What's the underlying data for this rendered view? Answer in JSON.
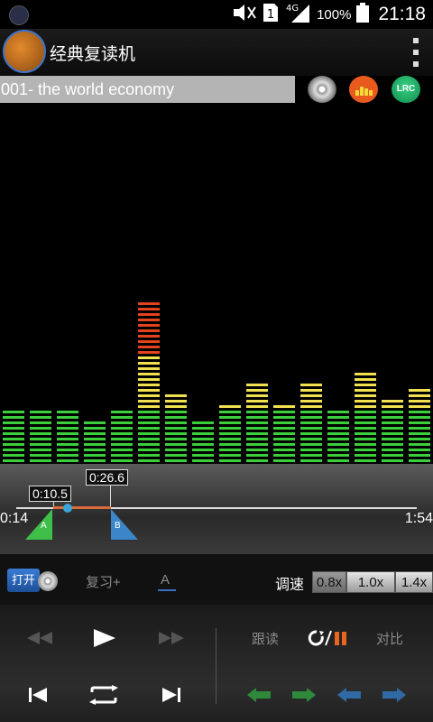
{
  "status_bar": {
    "battery": "100%",
    "time": "21:18",
    "network": "4G",
    "sim": "1",
    "icons": [
      "equalizer-icon",
      "mute-icon",
      "sim-icon",
      "signal-icon",
      "battery-icon"
    ]
  },
  "app": {
    "title": "经典复读机",
    "logo": "app-logo"
  },
  "track": {
    "title": "001- the world economy",
    "buttons": [
      "cd-icon",
      "equalizer-icon",
      "lrc-icon"
    ],
    "lrc_label": "LRC"
  },
  "spectrum": {
    "colors": {
      "green": "#3ccf3c",
      "yellow": "#f1e150",
      "red": "#e4441d"
    },
    "levels": [
      10,
      10,
      10,
      8,
      10,
      30,
      13,
      8,
      11,
      15,
      11,
      15,
      10,
      17,
      12,
      14
    ]
  },
  "timeline": {
    "start_time": "0:14",
    "end_time": "1:54",
    "marker_a_time": "0:10.5",
    "marker_b_time": "0:26.6",
    "marker_a": "A",
    "marker_b": "B"
  },
  "controls": {
    "open_label": "打开",
    "review_label": "复习+",
    "a_label": "A",
    "speed_label": "调速",
    "speeds": [
      "0.8x",
      "1.0x",
      "1.4x"
    ],
    "speed_selected": "0.8x",
    "follow_label": "跟读",
    "compare_label": "对比",
    "accent_color": "#e8651e"
  }
}
